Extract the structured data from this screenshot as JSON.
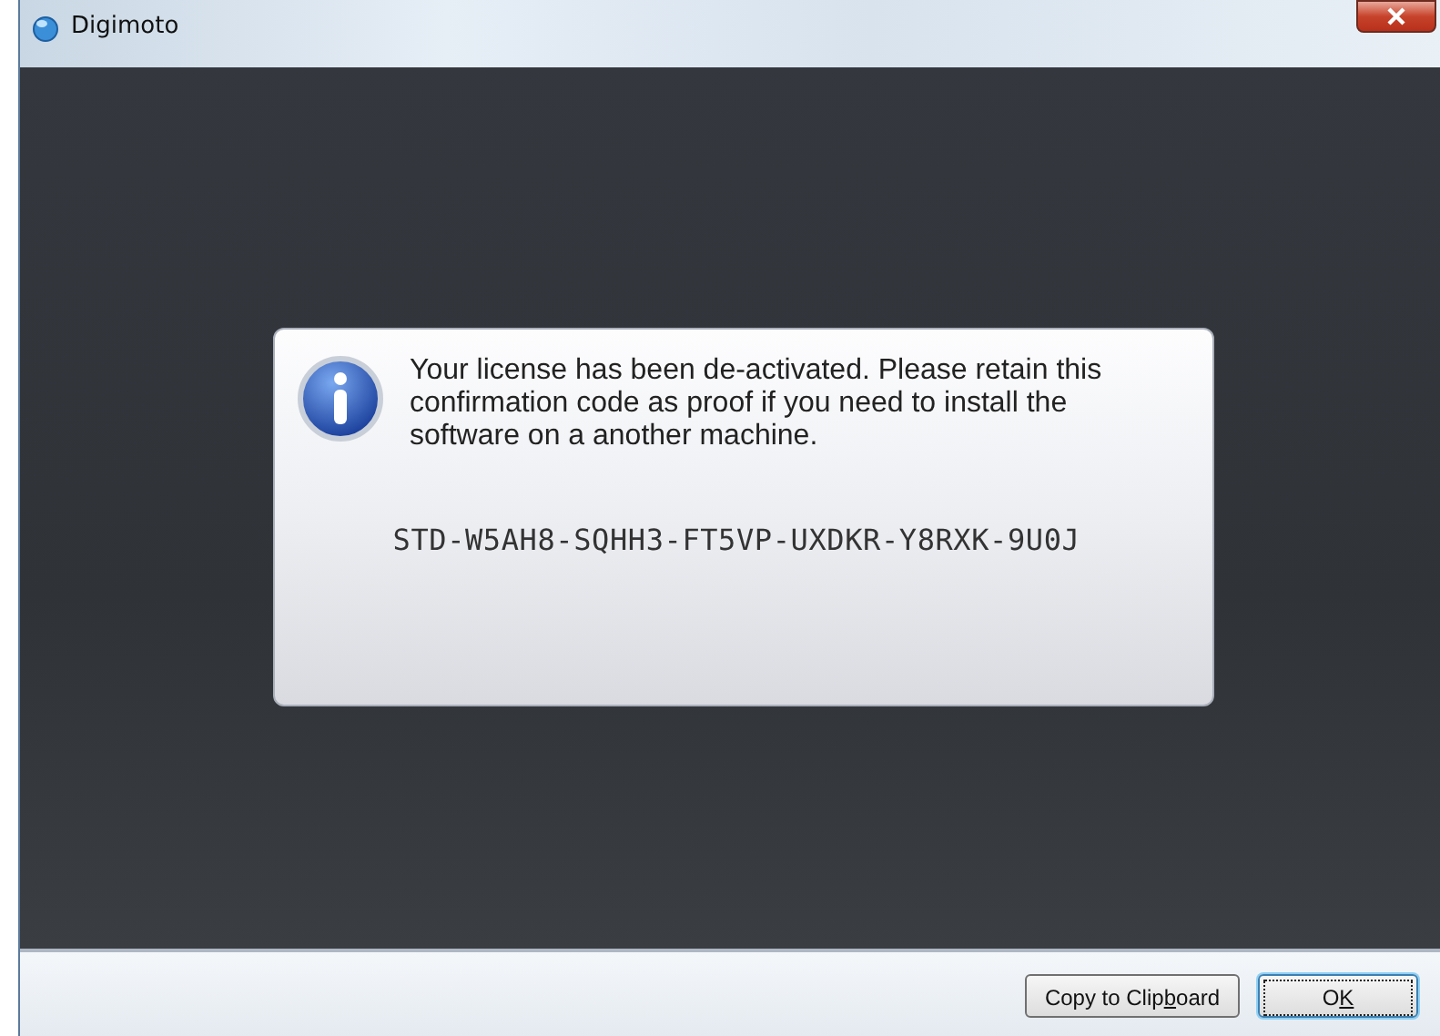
{
  "window": {
    "title": "Digimoto"
  },
  "message": {
    "text": "Your license has been de-activated. Please retain this confirmation code as proof if you need to install the software on a another machine.",
    "code": "STD-W5AH8-SQHH3-FT5VP-UXDKR-Y8RXK-9U0J"
  },
  "buttons": [
    {
      "kind": "copy",
      "text_before": "Copy to Clip",
      "access_key": "b",
      "text_after": "oard",
      "focused": false
    },
    {
      "kind": "ok",
      "text_before": "O",
      "access_key": "K",
      "focused": true
    }
  ]
}
